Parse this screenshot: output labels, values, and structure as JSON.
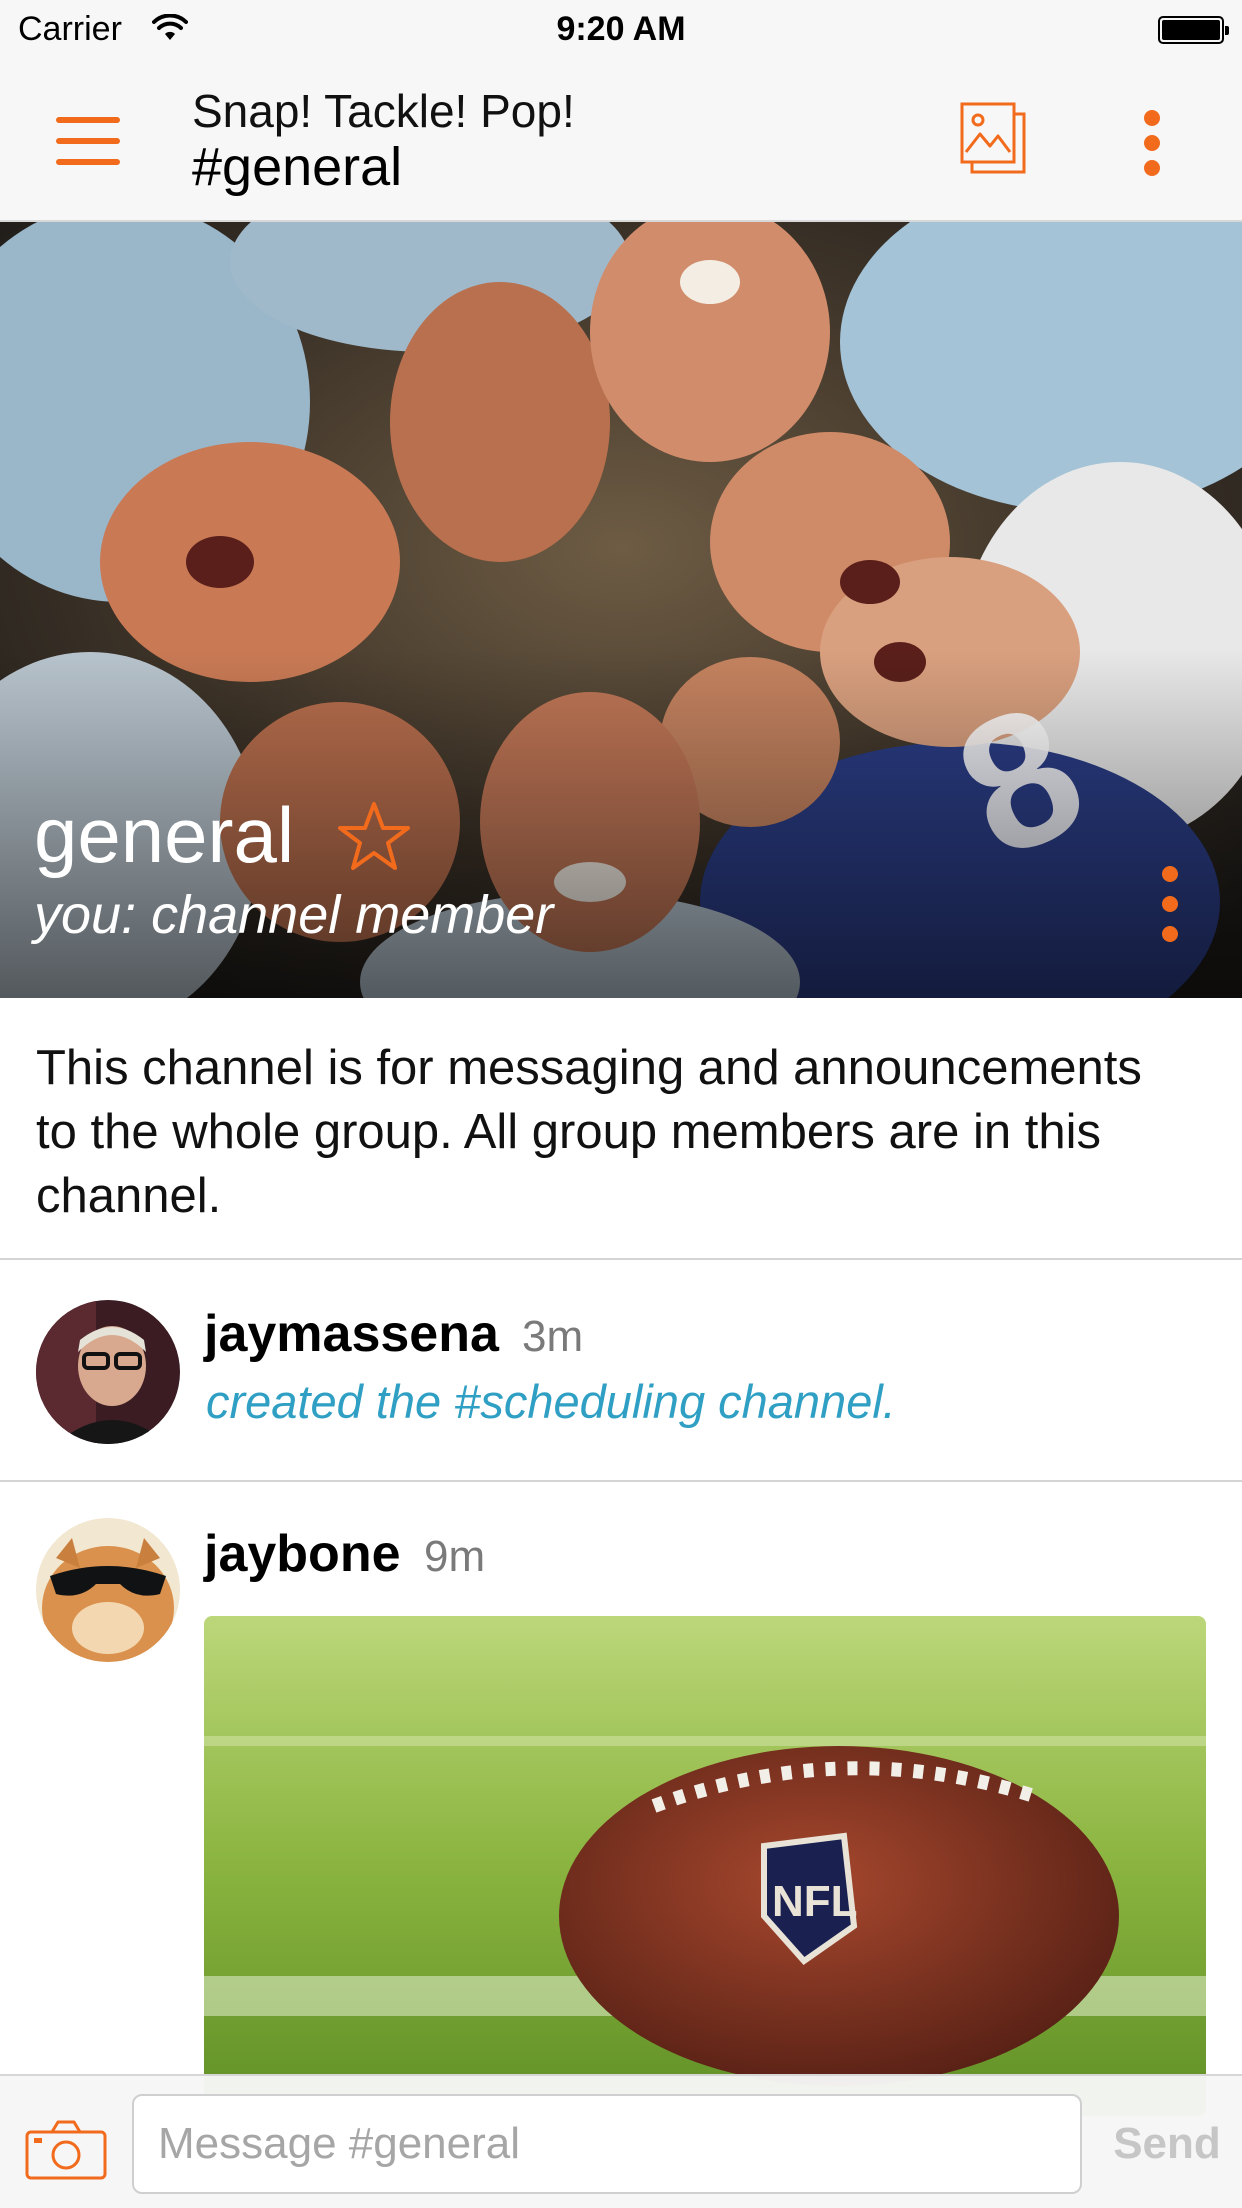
{
  "status_bar": {
    "carrier": "Carrier",
    "time": "9:20 AM"
  },
  "nav": {
    "group_name": "Snap! Tackle! Pop!",
    "channel": "#general"
  },
  "hero": {
    "title": "general",
    "membership": "you: channel member"
  },
  "description": "This channel is for messaging and announcements to the whole group. All group members are in this channel.",
  "messages": [
    {
      "author": "jaymassena",
      "time": "3m",
      "text": "created the #scheduling channel."
    },
    {
      "author": "jaybone",
      "time": "9m"
    }
  ],
  "compose": {
    "placeholder": "Message #general",
    "send_label": "Send"
  },
  "colors": {
    "accent": "#f26b1d",
    "system_text": "#2f9fc4"
  },
  "icons": [
    "menu-icon",
    "gallery-icon",
    "more-vertical-icon",
    "star-icon",
    "camera-icon",
    "wifi-icon",
    "battery-icon"
  ]
}
